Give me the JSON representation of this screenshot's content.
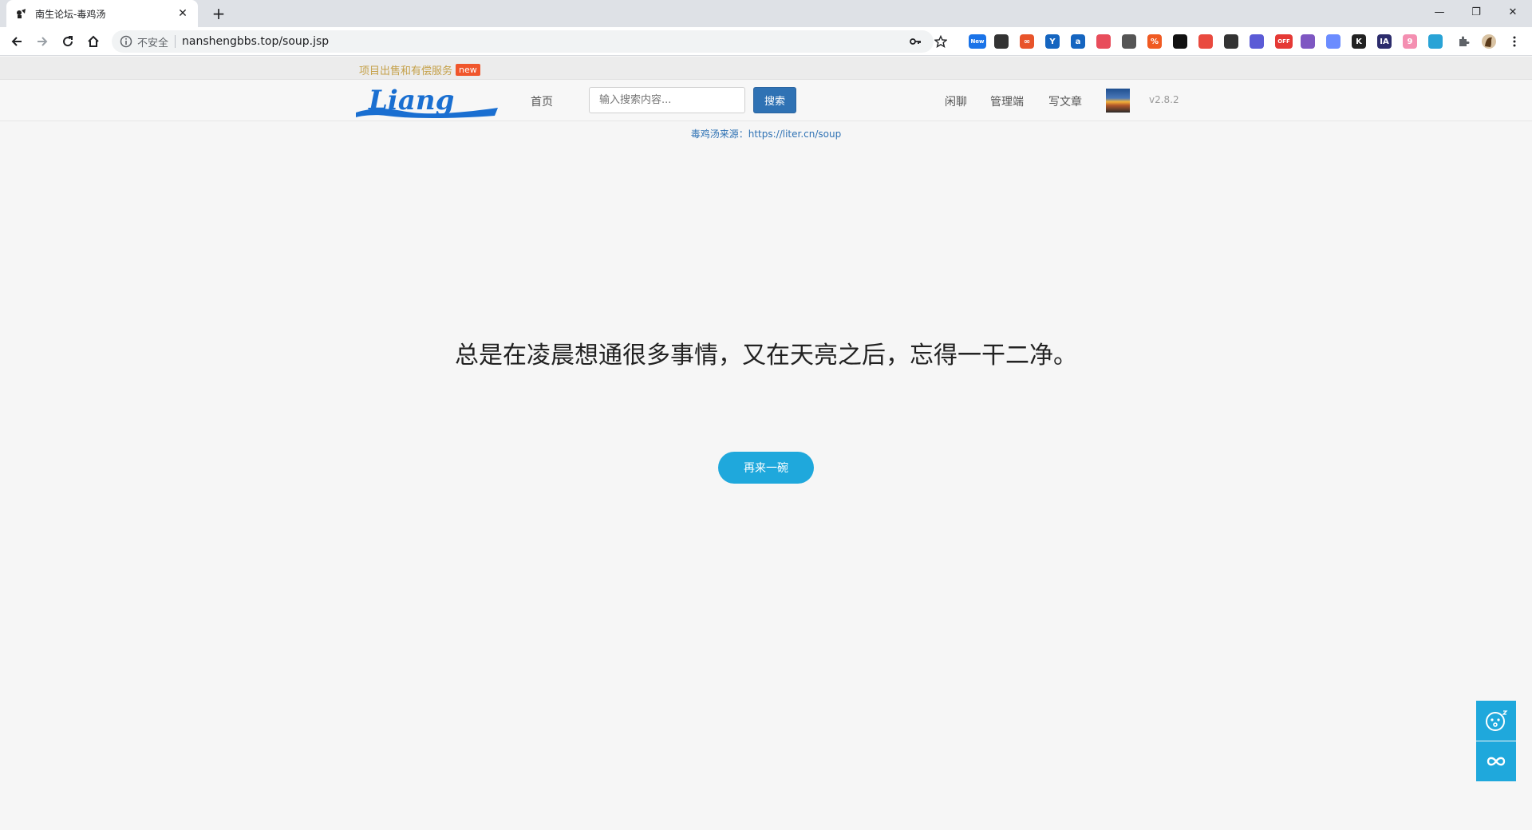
{
  "browser": {
    "tab_title": "南生论坛-毒鸡汤",
    "tab_close": "✕",
    "new_tab": "+",
    "win_minimize": "—",
    "win_restore": "❐",
    "win_close": "✕",
    "insecure_label": "不安全",
    "url": "nanshengbbs.top/soup.jsp",
    "extensions": [
      {
        "name": "new-ext",
        "label": "New",
        "color": "#1a73e8"
      },
      {
        "name": "ext-2",
        "label": "",
        "color": "#333333"
      },
      {
        "name": "ext-3",
        "label": "∞",
        "color": "#e8542b"
      },
      {
        "name": "ext-4",
        "label": "Y",
        "color": "#1565c0"
      },
      {
        "name": "ext-5",
        "label": "a",
        "color": "#1565c0"
      },
      {
        "name": "ext-6",
        "label": "",
        "color": "#e84d5b"
      },
      {
        "name": "ext-7",
        "label": "",
        "color": "#555555"
      },
      {
        "name": "ext-8",
        "label": "%",
        "color": "#f05a22"
      },
      {
        "name": "ext-9",
        "label": "",
        "color": "#111111"
      },
      {
        "name": "ext-10",
        "label": "",
        "color": "#e94a3f"
      },
      {
        "name": "ext-11",
        "label": "",
        "color": "#333333"
      },
      {
        "name": "ext-12",
        "label": "",
        "color": "#5b5bd6"
      },
      {
        "name": "ext-off",
        "label": "OFF",
        "color": "#e53935"
      },
      {
        "name": "ext-14",
        "label": "",
        "color": "#7e57c2"
      },
      {
        "name": "ext-15",
        "label": "",
        "color": "#6b8cff"
      },
      {
        "name": "ext-k",
        "label": "K",
        "color": "#222222"
      },
      {
        "name": "ext-ia",
        "label": "IA",
        "color": "#2c2c6c"
      },
      {
        "name": "ext-18",
        "label": "9",
        "color": "#f48fb1"
      },
      {
        "name": "ext-19",
        "label": "",
        "color": "#29a3d6"
      }
    ]
  },
  "promo": {
    "text": "项目出售和有偿服务",
    "badge": "new"
  },
  "nav": {
    "logo_text": "Liang",
    "home": "首页",
    "search_placeholder": "输入搜索内容...",
    "search_button": "搜索",
    "chat": "闲聊",
    "admin": "管理端",
    "write": "写文章",
    "version": "v2.8.2"
  },
  "content": {
    "source": "毒鸡汤来源：https://liter.cn/soup",
    "quote": "总是在凌晨想通很多事情，又在天亮之后，忘得一干二净。",
    "again_button": "再来一碗"
  }
}
